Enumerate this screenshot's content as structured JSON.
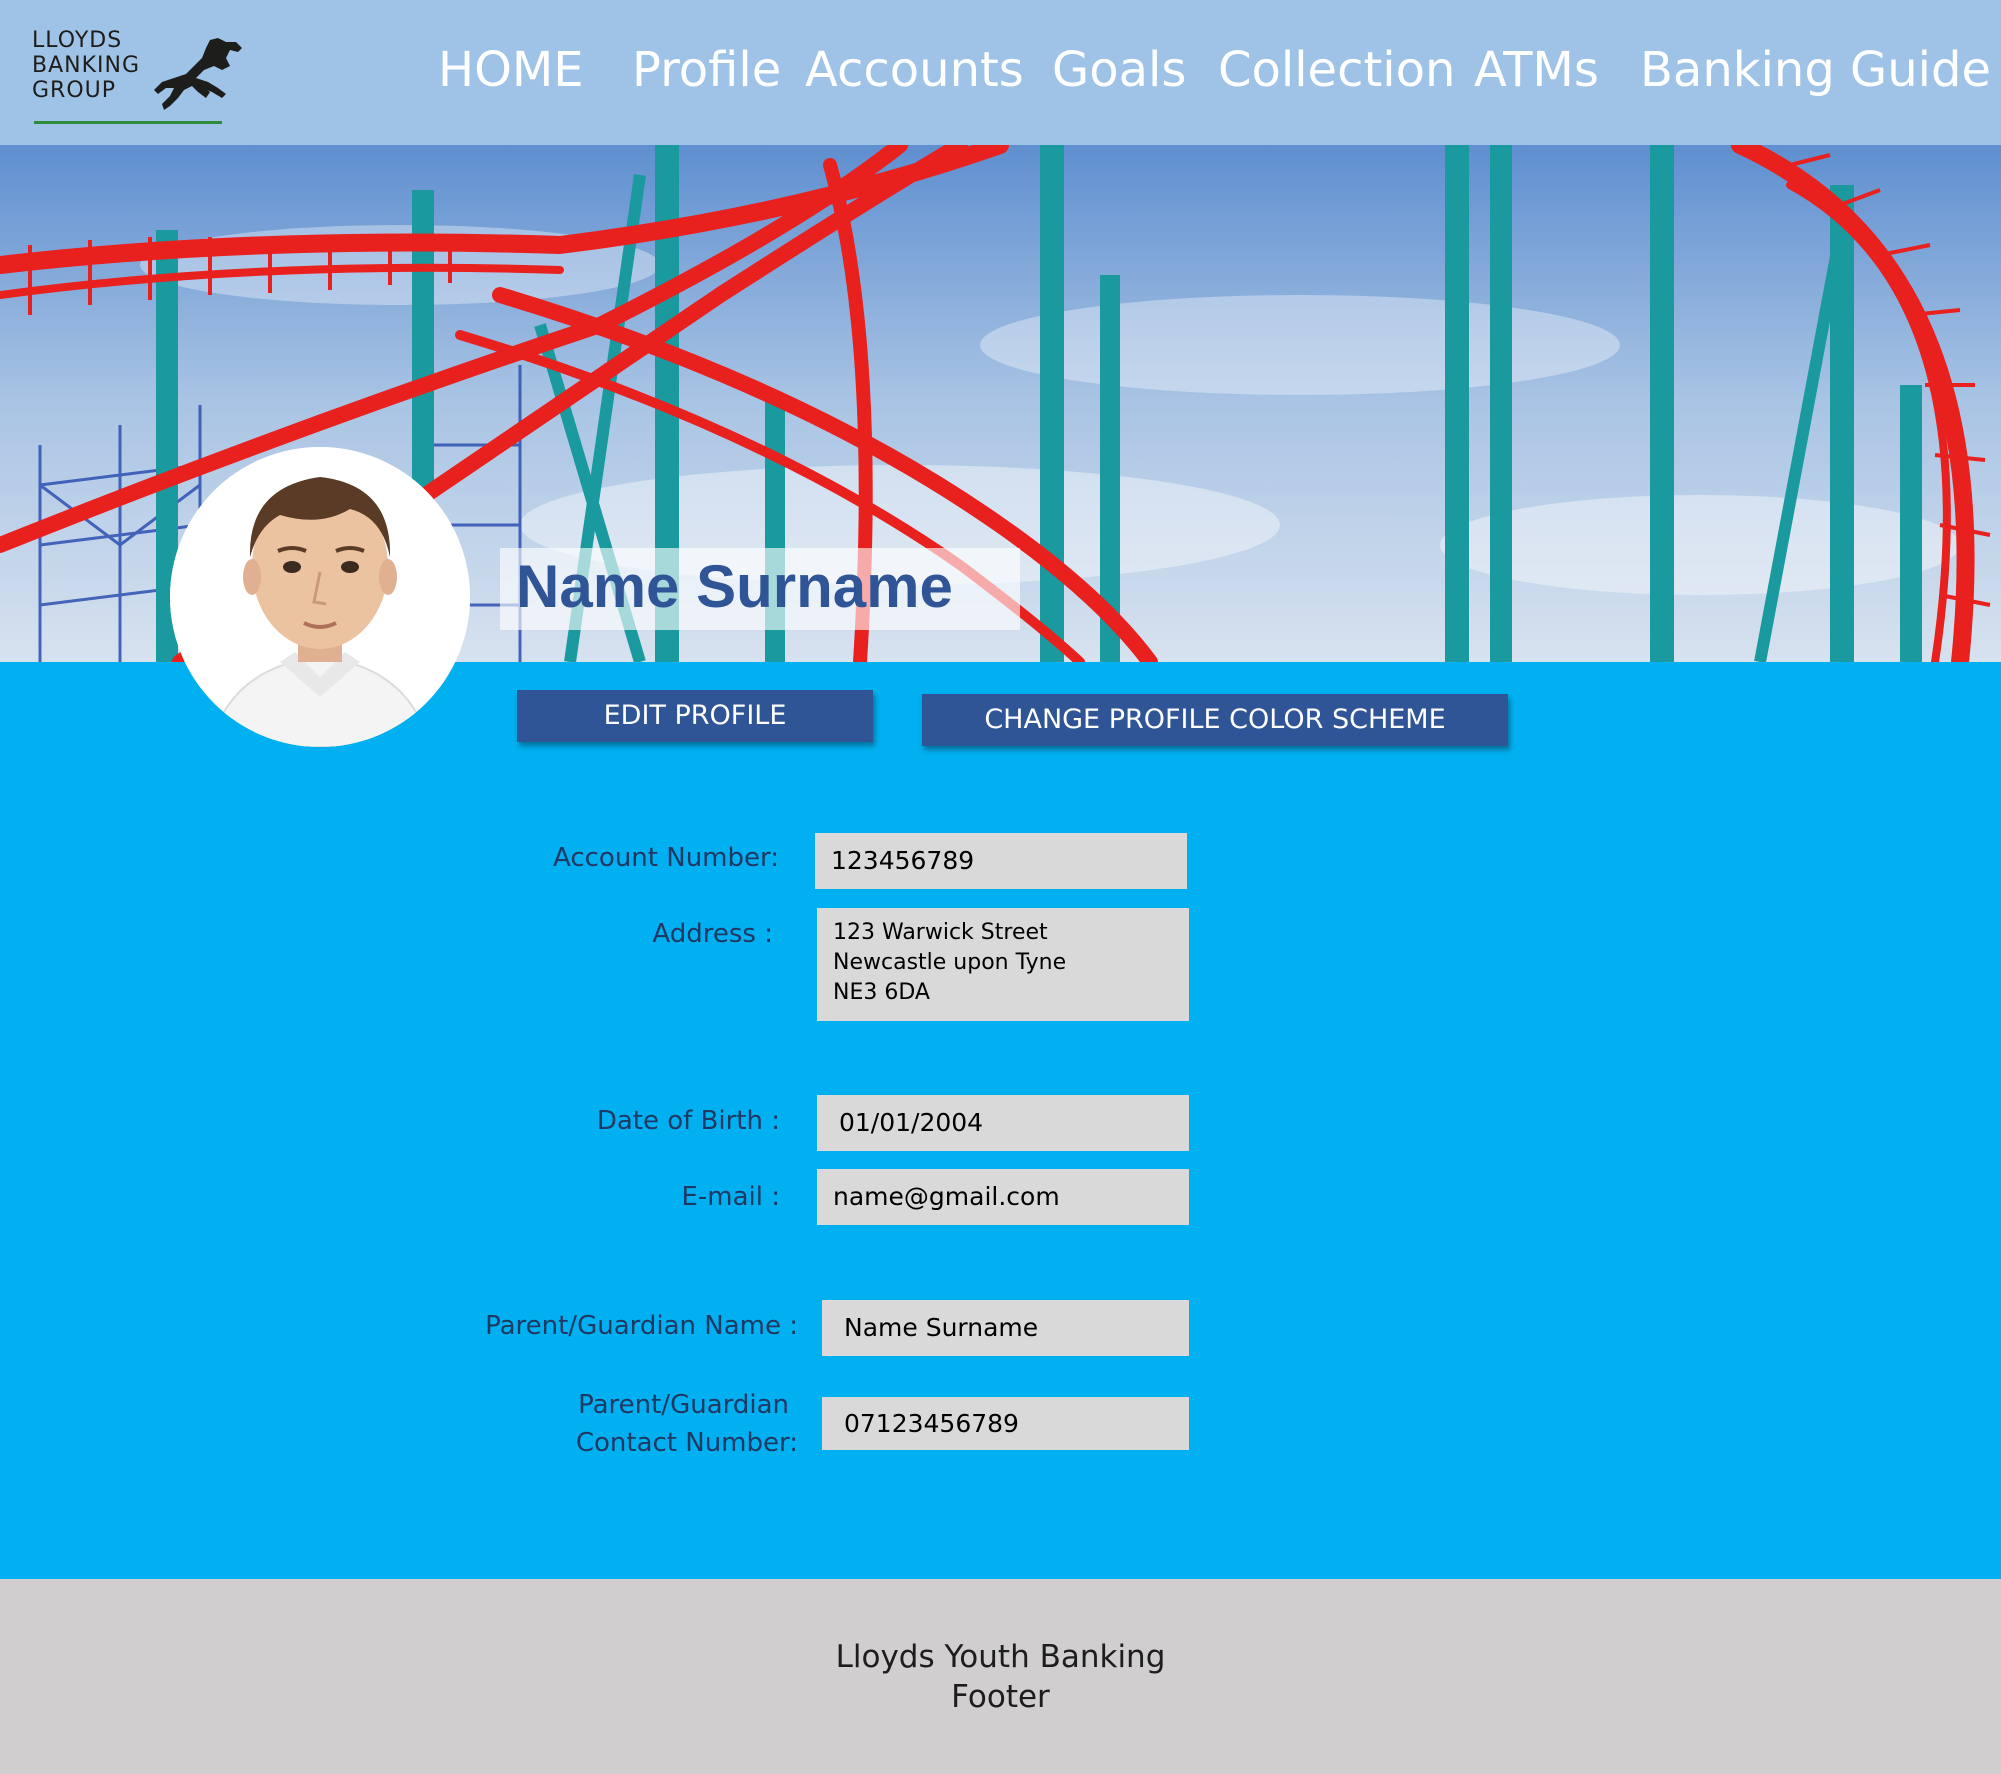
{
  "brand": {
    "logo_lines": [
      "LLOYDS",
      "BANKING",
      "GROUP"
    ],
    "logo_icon": "black-horse-icon",
    "underline_color": "#2e8b3a"
  },
  "nav": {
    "items": [
      "HOME",
      "Profile",
      "Accounts",
      "Goals",
      "Collection",
      "ATMs",
      "Banking Guide"
    ]
  },
  "profile": {
    "name": "Name Surname",
    "edit_button": "EDIT PROFILE",
    "color_scheme_button": "CHANGE PROFILE COLOR SCHEME"
  },
  "fields": {
    "account_number": {
      "label": "Account Number:",
      "value": "123456789"
    },
    "address": {
      "label": "Address :",
      "lines": [
        "123 Warwick Street",
        "Newcastle upon Tyne",
        "NE3 6DA"
      ]
    },
    "date_of_birth": {
      "label": "Date of Birth :",
      "value": "01/01/2004"
    },
    "email": {
      "label": "E-mail  :",
      "value": "name@gmail.com"
    },
    "guardian_name": {
      "label": "Parent/Guardian Name :",
      "value": "Name Surname"
    },
    "guardian_contact": {
      "label_line1": "Parent/Guardian",
      "label_line2": "Contact Number:",
      "value": "07123456789"
    }
  },
  "footer": {
    "line1": "Lloyds Youth Banking",
    "line2": "Footer"
  },
  "colors": {
    "header": "#9fc3e6",
    "main": "#00b0f0",
    "button": "#2f5597",
    "name_text": "#2f5597",
    "label_text": "#1f3864",
    "field": "#d9d9d9",
    "footer": "#d0cece"
  }
}
